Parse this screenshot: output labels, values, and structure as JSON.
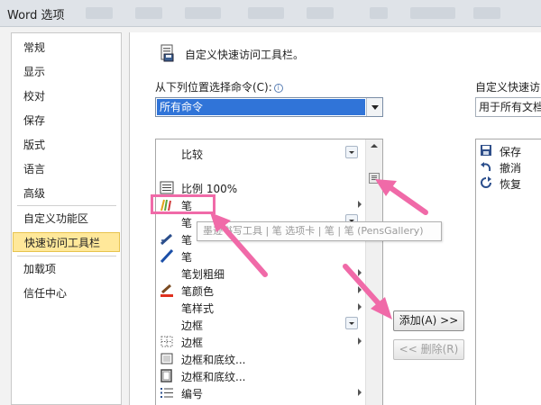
{
  "window": {
    "title": "Word 选项"
  },
  "nav": {
    "items": [
      {
        "label": "常规",
        "active": false
      },
      {
        "label": "显示",
        "active": false
      },
      {
        "label": "校对",
        "active": false
      },
      {
        "label": "保存",
        "active": false
      },
      {
        "label": "版式",
        "active": false
      },
      {
        "label": "语言",
        "active": false
      },
      {
        "label": "高级",
        "active": false
      },
      {
        "label": "自定义功能区",
        "active": false
      },
      {
        "label": "快速访问工具栏",
        "active": true
      },
      {
        "label": "加载项",
        "active": false
      },
      {
        "label": "信任中心",
        "active": false
      }
    ]
  },
  "header": {
    "title": "自定义快速访问工具栏。",
    "icon": "qat-customize-icon"
  },
  "choose_commands": {
    "label": "从下列位置选择命令(C):",
    "selected": "所有命令"
  },
  "customize_qat": {
    "label": "自定义快速访问",
    "selected": "用于所有文档"
  },
  "commands": [
    {
      "label": "比较",
      "icon": "",
      "has_submenu": false,
      "has_dropdown": true
    },
    {
      "label": "比例 100%",
      "icon": "zoom-100-icon",
      "has_submenu": false,
      "has_dropdown": false
    },
    {
      "label": "笔",
      "icon": "pens-gallery-icon",
      "has_submenu": true,
      "has_dropdown": false
    },
    {
      "label": "笔",
      "icon": "",
      "has_submenu": false,
      "has_dropdown": true
    },
    {
      "label": "笔",
      "icon": "pen-icon",
      "has_submenu": false,
      "has_dropdown": false
    },
    {
      "label": "笔",
      "icon": "pen-blue-icon",
      "has_submenu": false,
      "has_dropdown": false
    },
    {
      "label": "笔划粗细",
      "icon": "",
      "has_submenu": true,
      "has_dropdown": false
    },
    {
      "label": "笔颜色",
      "icon": "pen-color-icon",
      "has_submenu": true,
      "has_dropdown": false
    },
    {
      "label": "笔样式",
      "icon": "",
      "has_submenu": true,
      "has_dropdown": false
    },
    {
      "label": "边框",
      "icon": "",
      "has_submenu": false,
      "has_dropdown": true
    },
    {
      "label": "边框",
      "icon": "border-icon",
      "has_submenu": true,
      "has_dropdown": false
    },
    {
      "label": "边框和底纹...",
      "icon": "borders-shading-icon",
      "has_submenu": false,
      "has_dropdown": false
    },
    {
      "label": "边框和底纹...",
      "icon": "page-border-icon",
      "has_submenu": false,
      "has_dropdown": false
    },
    {
      "label": "编号",
      "icon": "numbering-icon",
      "has_submenu": true,
      "has_dropdown": false
    }
  ],
  "tooltip": "墨迹书写工具 | 笔 选项卡 | 笔 | 笔 (PensGallery)",
  "buttons": {
    "add": "添加(A) >>",
    "remove": "<< 删除(R)"
  },
  "qat_items": [
    {
      "label": "保存",
      "icon": "save-icon"
    },
    {
      "label": "撤消",
      "icon": "undo-icon"
    },
    {
      "label": "恢复",
      "icon": "redo-icon"
    }
  ],
  "colors": {
    "selection": "#3074d8",
    "nav_active": "#ffe89a",
    "annotation": "#f06aa8"
  }
}
